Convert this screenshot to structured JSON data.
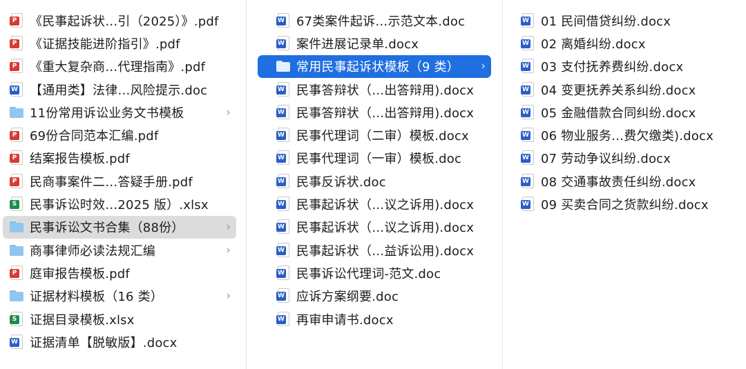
{
  "columns": [
    {
      "items": [
        {
          "label": "《民事起诉状…引（2025）》.pdf",
          "type": "pdf"
        },
        {
          "label": "《证据技能进阶指引》.pdf",
          "type": "pdf"
        },
        {
          "label": "《重大复杂商…代理指南》.pdf",
          "type": "pdf"
        },
        {
          "label": "【通用类】法律…风险提示.doc",
          "type": "word"
        },
        {
          "label": "11份常用诉讼业务文书模板",
          "type": "folder"
        },
        {
          "label": "69份合同范本汇编.pdf",
          "type": "pdf"
        },
        {
          "label": "结案报告模板.pdf",
          "type": "pdf"
        },
        {
          "label": "民商事案件二…答疑手册.pdf",
          "type": "pdf"
        },
        {
          "label": "民事诉讼时效…2025 版）.xlsx",
          "type": "xls"
        },
        {
          "label": "民事诉讼文书合集（88份）",
          "type": "folder",
          "selected": "gray"
        },
        {
          "label": "商事律师必读法规汇编",
          "type": "folder"
        },
        {
          "label": "庭审报告模板.pdf",
          "type": "pdf"
        },
        {
          "label": "证据材料模板（16 类）",
          "type": "folder"
        },
        {
          "label": "证据目录模板.xlsx",
          "type": "xls"
        },
        {
          "label": "证据清单【脱敏版】.docx",
          "type": "word"
        }
      ]
    },
    {
      "items": [
        {
          "label": "67类案件起诉…示范文本.doc",
          "type": "word"
        },
        {
          "label": "案件进展记录单.docx",
          "type": "word"
        },
        {
          "label": "常用民事起诉状模板（9 类）",
          "type": "folder",
          "selected": "blue"
        },
        {
          "label": "民事答辩状（…出答辩用).docx",
          "type": "word"
        },
        {
          "label": "民事答辩状（…出答辩用).docx",
          "type": "word"
        },
        {
          "label": "民事代理词（二审）模板.docx",
          "type": "word"
        },
        {
          "label": "民事代理词（一审）模板.doc",
          "type": "word"
        },
        {
          "label": "民事反诉状.doc",
          "type": "word"
        },
        {
          "label": "民事起诉状（…议之诉用).docx",
          "type": "word"
        },
        {
          "label": "民事起诉状（…议之诉用).docx",
          "type": "word"
        },
        {
          "label": "民事起诉状（…益诉讼用).docx",
          "type": "word"
        },
        {
          "label": "民事诉讼代理词-范文.doc",
          "type": "word"
        },
        {
          "label": "应诉方案纲要.doc",
          "type": "word"
        },
        {
          "label": "再审申请书.docx",
          "type": "word"
        }
      ]
    },
    {
      "items": [
        {
          "label": "01 民间借贷纠纷.docx",
          "type": "word"
        },
        {
          "label": "02 离婚纠纷.docx",
          "type": "word"
        },
        {
          "label": "03 支付抚养费纠纷.docx",
          "type": "word"
        },
        {
          "label": "04 变更抚养关系纠纷.docx",
          "type": "word"
        },
        {
          "label": "05 金融借款合同纠纷.docx",
          "type": "word"
        },
        {
          "label": "06 物业服务…费欠缴类).docx",
          "type": "word"
        },
        {
          "label": "07 劳动争议纠纷.docx",
          "type": "word"
        },
        {
          "label": "08 交通事故责任纠纷.docx",
          "type": "word"
        },
        {
          "label": "09 买卖合同之货款纠纷.docx",
          "type": "word"
        }
      ]
    }
  ],
  "icons": {
    "pdf": "pdf-file-icon",
    "word": "word-file-icon",
    "xls": "excel-file-icon",
    "folder": "folder-icon",
    "chevron": "chevron-right-icon"
  },
  "glyphs": {
    "pdf": "P",
    "word": "W",
    "xls": "S",
    "chevron": "›"
  },
  "colors": {
    "selection_blue": "#1f6fe0",
    "selection_gray": "#dcdcdc",
    "pdf": "#d93a34",
    "word": "#2b5ec9",
    "xls": "#1f8c4e",
    "folder": "#8fc7f2"
  }
}
